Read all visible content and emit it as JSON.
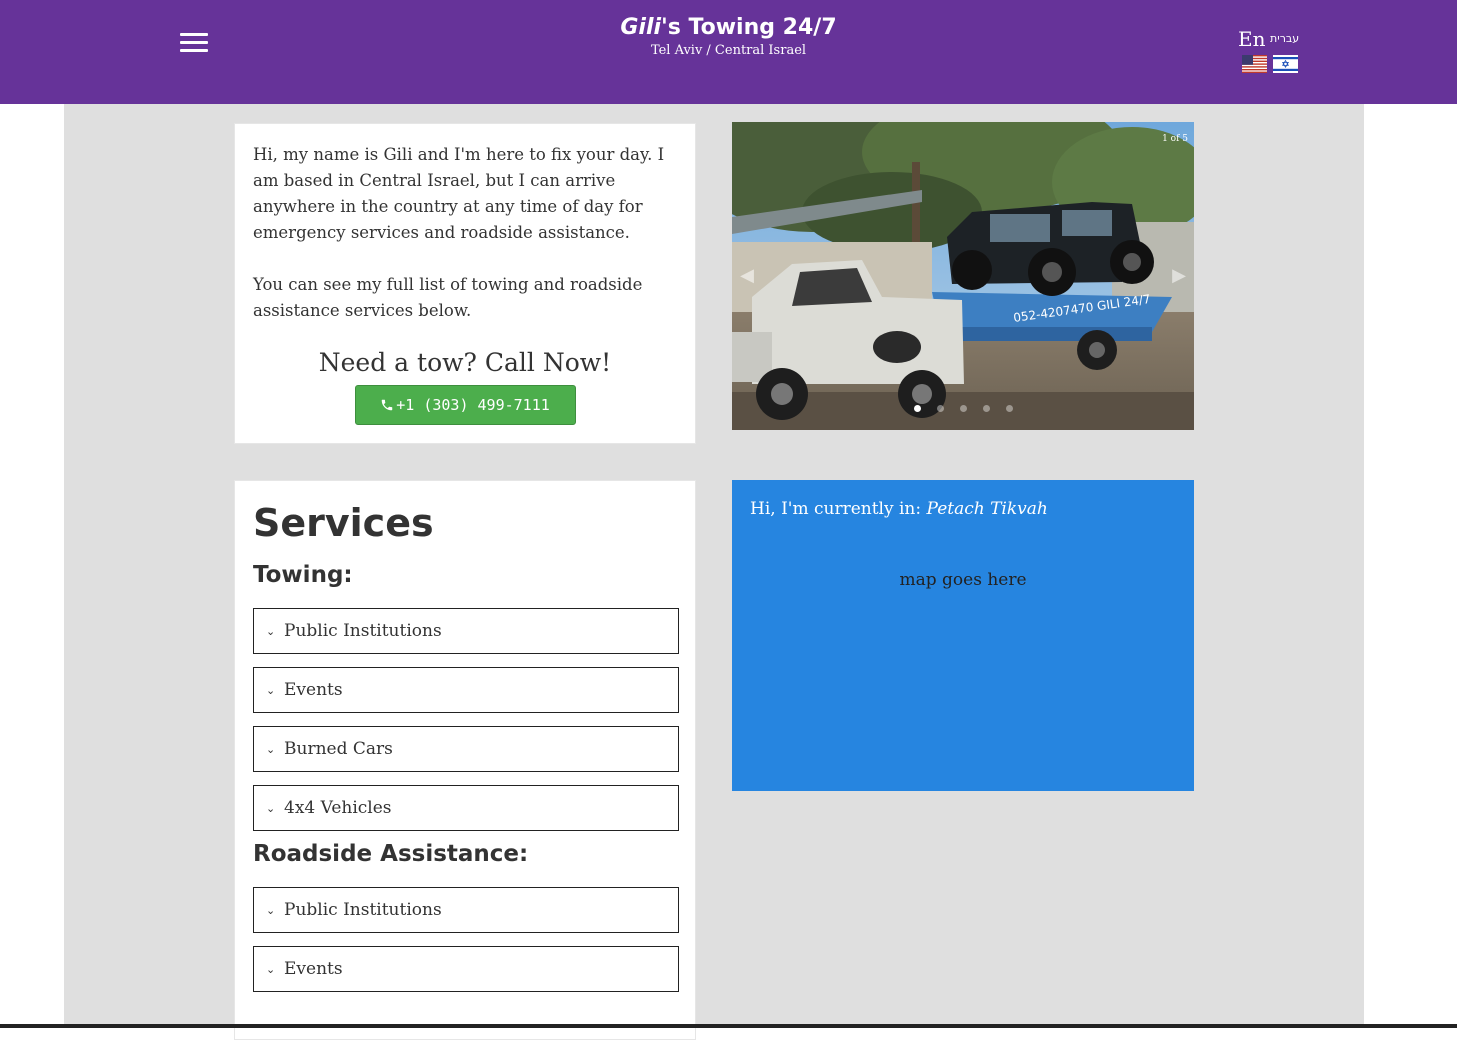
{
  "header": {
    "title_italic": "Gili",
    "title_rest": "'s Towing 24/7",
    "subtitle": "Tel Aviv / Central Israel",
    "lang_en": "En",
    "lang_he": "עברית",
    "icons": {
      "menu": "hamburger-menu-icon",
      "us_flag": "us-flag-icon",
      "il_flag": "israel-flag-icon"
    },
    "colors": {
      "header_bg": "#663399"
    }
  },
  "intro": {
    "paragraph1": "Hi, my name is Gili and I'm here to fix your day. I am based in Central Israel, but I can arrive anywhere in the country at any time of day for emergency services and roadside assistance.",
    "paragraph2": "You can see my full list of towing and roadside assistance services below.",
    "cta_title": "Need a tow? Call Now!",
    "phone": "+1 (303) 499-7111",
    "colors": {
      "call_button": "#4cae4c"
    }
  },
  "slider": {
    "counter": "1 of 5",
    "slide_count": 5,
    "active_index": 0,
    "truck_text": "052-4207470 GILI 24/7"
  },
  "services": {
    "title": "Services",
    "towing_heading": "Towing:",
    "towing_items": [
      "Public Institutions",
      "Events",
      "Burned Cars",
      "4x4 Vehicles"
    ],
    "roadside_heading": "Roadside Assistance:",
    "roadside_items": [
      "Public Institutions",
      "Events"
    ]
  },
  "location": {
    "label": "Hi, I'm currently in: ",
    "city": "Petach Tikvah",
    "map_placeholder": "map goes here",
    "colors": {
      "map_bg": "#2685e0"
    }
  }
}
